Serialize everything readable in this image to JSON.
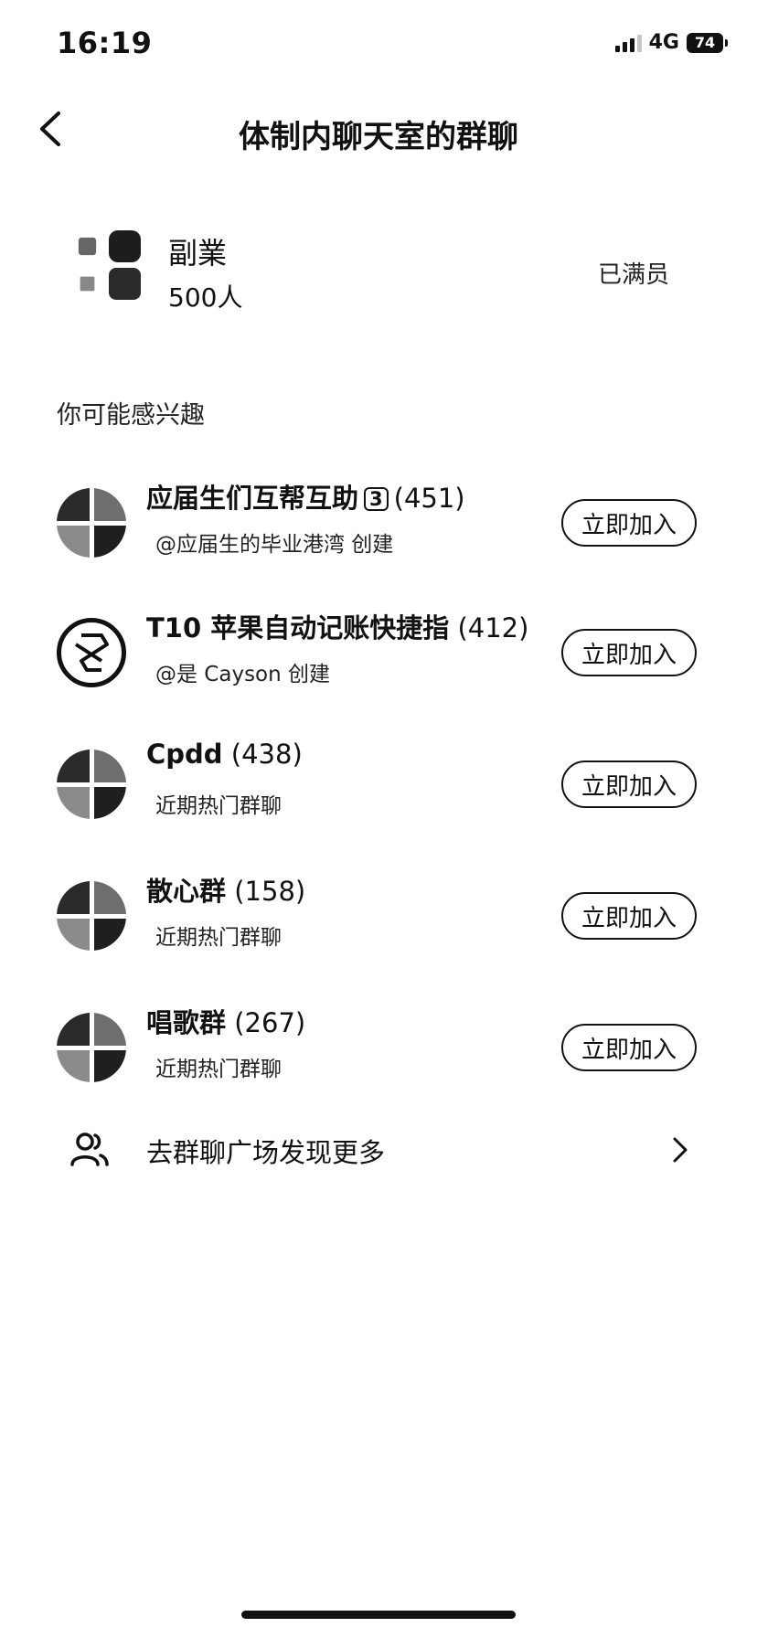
{
  "status_bar": {
    "time": "16:19",
    "network": "4G",
    "battery": "74"
  },
  "nav": {
    "title": "体制内聊天室的群聊"
  },
  "current_group": {
    "name": "副業",
    "member_count": "500人",
    "status": "已满员"
  },
  "section_title": "你可能感兴趣",
  "recommendations": [
    {
      "name": "应届生们互帮互助",
      "badge": "3",
      "count": "(451)",
      "subtitle": "@应届生的毕业港湾 创建",
      "button": "立即加入"
    },
    {
      "name": "T10 苹果自动记账快捷指",
      "badge": "",
      "count": "(412)",
      "subtitle": "@是 Cayson 创建",
      "button": "立即加入"
    },
    {
      "name": "Cpdd",
      "badge": "",
      "count": "(438)",
      "subtitle": "近期热门群聊",
      "button": "立即加入"
    },
    {
      "name": "散心群",
      "badge": "",
      "count": "(158)",
      "subtitle": "近期热门群聊",
      "button": "立即加入"
    },
    {
      "name": "唱歌群",
      "badge": "",
      "count": "(267)",
      "subtitle": "近期热门群聊",
      "button": "立即加入"
    }
  ],
  "more_link": {
    "label": "去群聊广场发现更多"
  }
}
